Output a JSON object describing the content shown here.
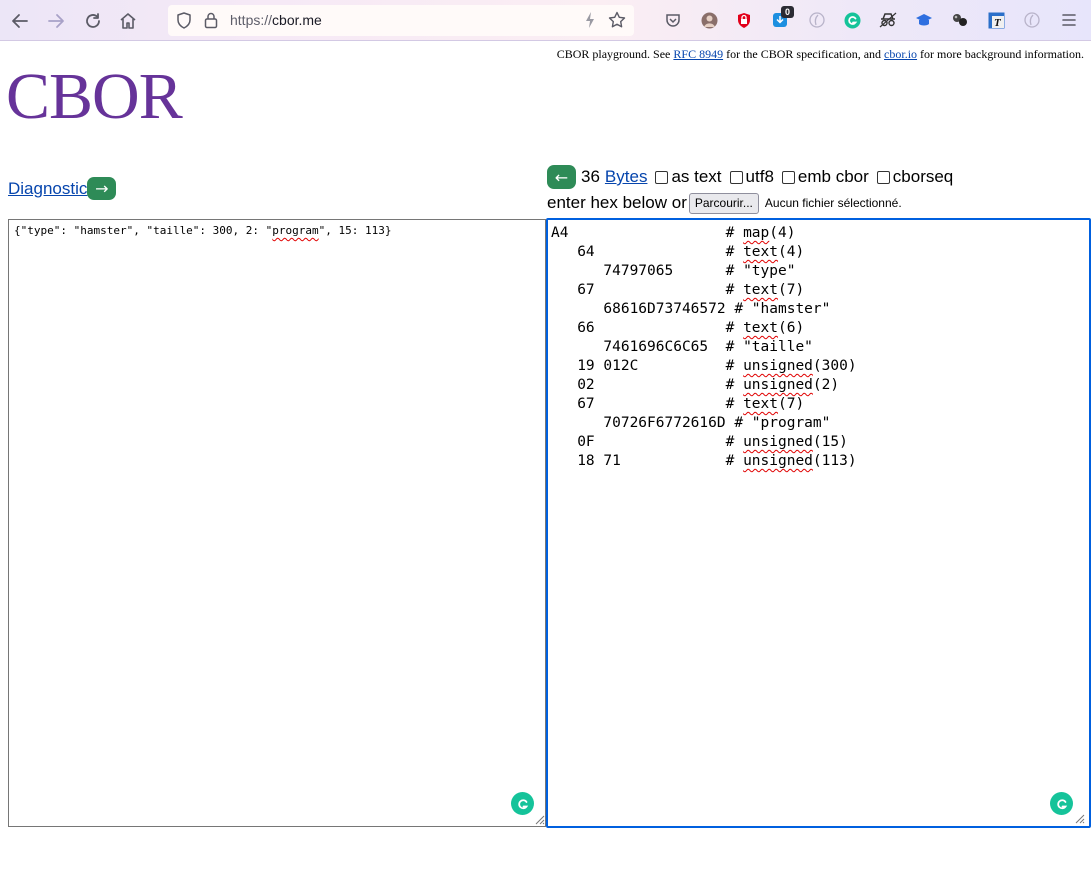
{
  "browser": {
    "url_scheme": "https://",
    "url_host": "cbor.me",
    "ext_badge_count": "0"
  },
  "page": {
    "info_prefix": "CBOR playground. See ",
    "rfc_link": "RFC 8949",
    "info_middle": " for the CBOR specification, and ",
    "cborio_link": "cbor.io",
    "info_suffix": " for more background information.",
    "logo": "CBOR",
    "diagnostic_link": "Diagnostic",
    "right_arrow": "→",
    "left_arrow": "←",
    "byte_count": "36",
    "bytes_link": "Bytes",
    "as_text_label": "as text",
    "utf8_label": "utf8",
    "emb_cbor_label": "emb cbor",
    "cborseq_label": "cborseq",
    "enter_hex_label": "enter hex below or",
    "file_button": "Parcourir...",
    "file_status": "Aucun fichier sélectionné."
  },
  "diagnostic_text": {
    "before": "{\"type\": \"hamster\", \"taille\": 300, 2: \"",
    "spell": "program",
    "after": "\", 15: 113}"
  },
  "hex_lines": [
    {
      "left": "A4                  ",
      "comment": "# ",
      "spell": "map",
      "rest": "(4)"
    },
    {
      "left": "   64               ",
      "comment": "# ",
      "spell": "text",
      "rest": "(4)"
    },
    {
      "left": "      74797065      ",
      "comment": "# ",
      "spell": "",
      "rest": "\"type\""
    },
    {
      "left": "   67               ",
      "comment": "# ",
      "spell": "text",
      "rest": "(7)"
    },
    {
      "left": "      68616D73746572 ",
      "comment": "# ",
      "spell": "",
      "rest": "\"hamster\""
    },
    {
      "left": "   66               ",
      "comment": "# ",
      "spell": "text",
      "rest": "(6)"
    },
    {
      "left": "      7461696C6C65  ",
      "comment": "# ",
      "spell": "",
      "rest": "\"taille\""
    },
    {
      "left": "   19 012C          ",
      "comment": "# ",
      "spell": "unsigned",
      "rest": "(300)"
    },
    {
      "left": "   02               ",
      "comment": "# ",
      "spell": "unsigned",
      "rest": "(2)"
    },
    {
      "left": "   67               ",
      "comment": "# ",
      "spell": "text",
      "rest": "(7)"
    },
    {
      "left": "      70726F6772616D ",
      "comment": "# ",
      "spell": "",
      "rest": "\"program\""
    },
    {
      "left": "   0F               ",
      "comment": "# ",
      "spell": "unsigned",
      "rest": "(15)"
    },
    {
      "left": "   18 71            ",
      "comment": "# ",
      "spell": "unsigned",
      "rest": "(113)"
    }
  ],
  "colors": {
    "accent_green": "#2e8b57",
    "logo_purple": "#663399",
    "focus_blue": "#0060df",
    "grammarly": "#15c39a"
  }
}
